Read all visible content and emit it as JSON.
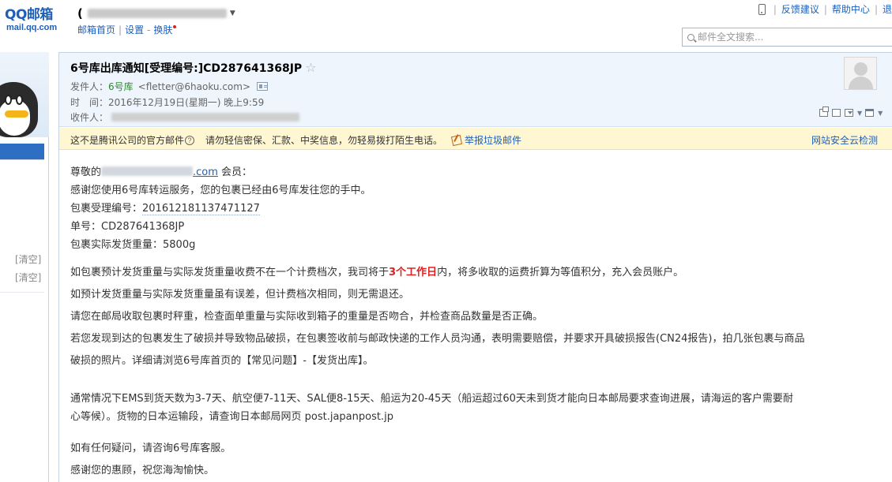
{
  "topbar": {
    "logo_main": "QQ邮箱",
    "logo_sub": "mail.qq.com",
    "account_paren": "(",
    "subnav": {
      "home": "邮箱首页",
      "settings": "设置",
      "skin": "换肤"
    },
    "links": {
      "feedback": "反馈建议",
      "help": "帮助中心",
      "logout": "退"
    },
    "search_placeholder": "邮件全文搜索..."
  },
  "leftpanel": {
    "clear_1": "[清空]",
    "clear_2": "[清空]"
  },
  "mail": {
    "subject": "6号库出库通知[受理编号:]CD287641368JP",
    "star": "☆",
    "sender_label": "发件人：",
    "sender_name": "6号库",
    "sender_email": "<fletter@6haoku.com>",
    "time_label": "时　间：",
    "time_value": "2016年12月19日(星期一) 晚上9:59",
    "recipient_label": "收件人："
  },
  "warning": {
    "official": "这不是腾讯公司的官方邮件",
    "help_glyph": "?",
    "message": "请勿轻信密保、汇款、中奖信息，勿轻易拨打陌生电话。",
    "report": "举报垃圾邮件",
    "scan": "网站安全云检测"
  },
  "body": {
    "greeting_prefix": "尊敬的",
    "greeting_suffix": ".com",
    "greeting_tail": " 会员：",
    "line_thanks": "感谢您使用6号库转运服务，您的包裹已经由6号库发往您的手中。",
    "line_receipt_label": "包裹受理编号：",
    "line_receipt_value": "201612181137471127",
    "line_tracking_label": "单号：",
    "line_tracking_value": "CD287641368JP",
    "line_weight": "包裹实际发货重量：5800g",
    "p1_before": "如包裹预计发货重量与实际发货重量收费不在一个计费档次，我司将于",
    "p1_red": "3个工作日",
    "p1_after": "内，将多收取的运费折算为等值积分，充入会员账户。",
    "p2": "如预计发货重量与实际发货重量虽有误差，但计费档次相同，则无需退还。",
    "p3": "请您在邮局收取包裹时秤重，检查面单重量与实际收到箱子的重量是否吻合，并检查商品数量是否正确。",
    "p4_line1": "若您发现到达的包裹发生了破损并导致物品破损，在包裹签收前与邮政快递的工作人员沟通，表明需要赔偿，并要求开具破损报告(CN24报告)，拍几张包裹与商品",
    "p4_line2": "破损的照片。详细请浏览6号库首页的【常见问题】-【发货出库】。",
    "p5_line1": "通常情况下EMS到货天数为3-7天、航空便7-11天、SAL便8-15天、船运为20-45天（船运超过60天未到货才能向日本邮局要求查询进展，请海运的客户需要耐",
    "p5_line2": "心等候）。货物的日本运输段，请查询日本邮局网页 post.japanpost.jp",
    "p6": "如有任何疑问，请咨询6号库客服。",
    "p7": "感谢您的惠顾，祝您海淘愉快。"
  }
}
